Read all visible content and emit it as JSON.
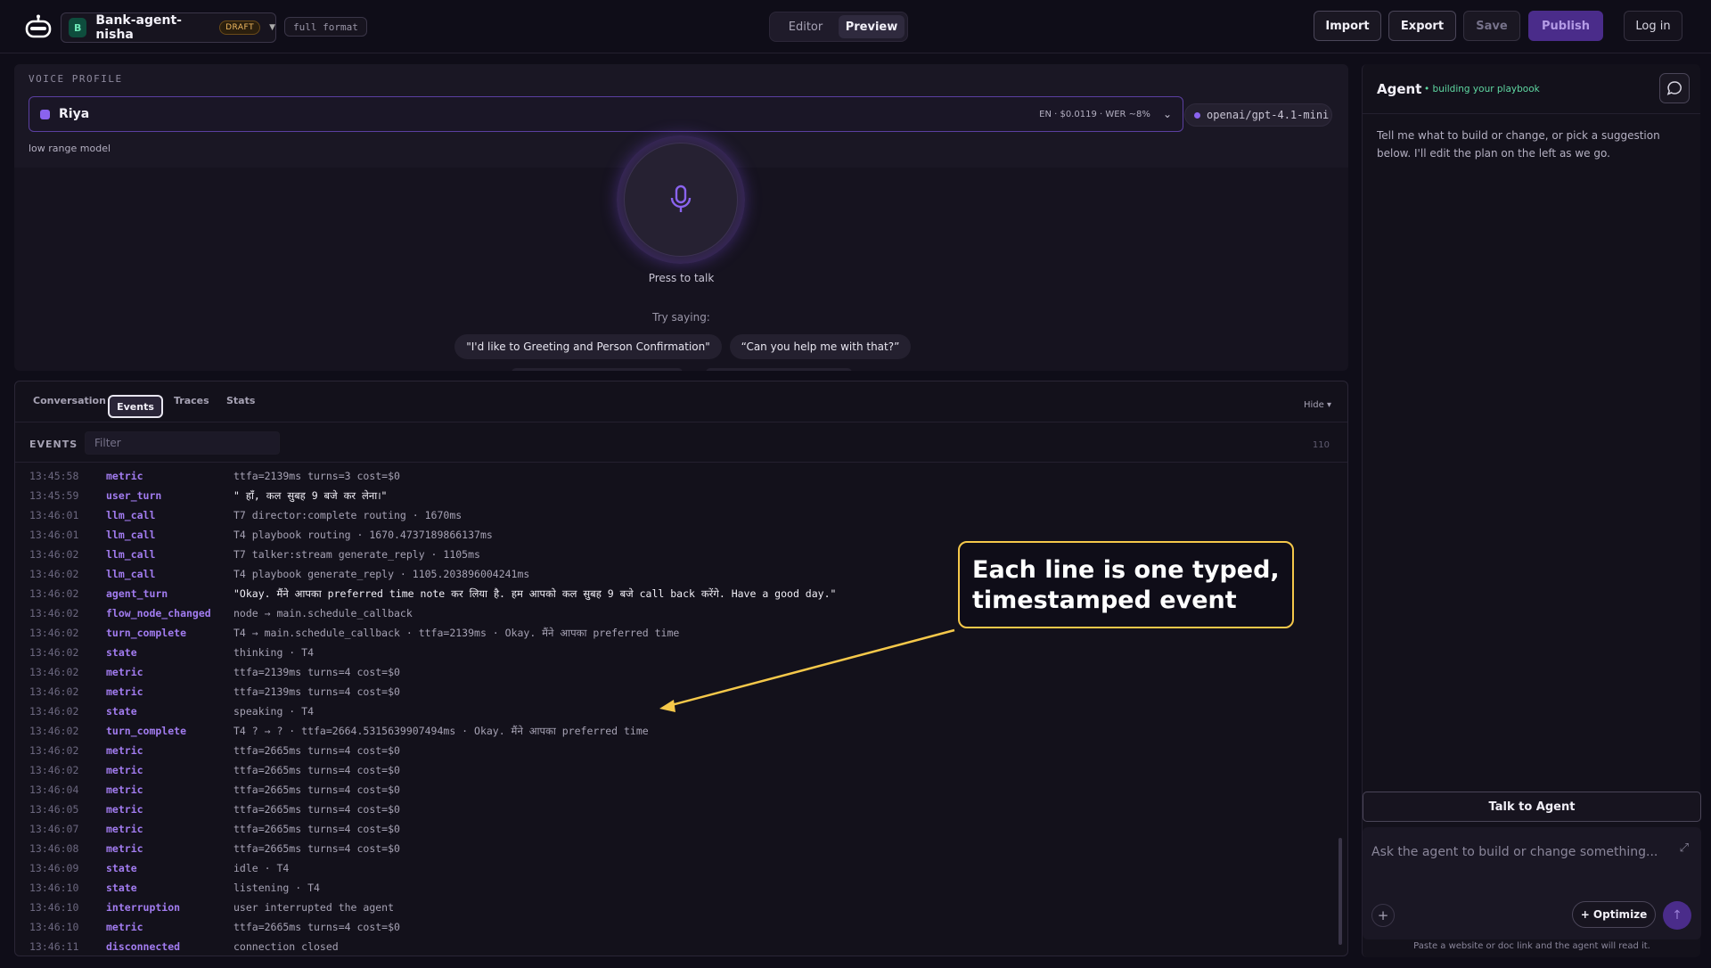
{
  "header": {
    "agent_initial": "B",
    "agent_name": "Bank-agent-nisha",
    "draft_badge": "DRAFT",
    "format_badge": "full format",
    "mode_tabs": [
      "Editor",
      "Preview"
    ],
    "active_mode": "Preview",
    "buttons": {
      "import": "Import",
      "export": "Export",
      "save": "Save",
      "publish": "Publish",
      "login": "Log in"
    }
  },
  "voice": {
    "section_title": "VOICE PROFILE",
    "voice_name": "Riya",
    "voice_meta": "EN · $0.0119 · WER ~8%",
    "model": "openai/gpt-4.1-mini",
    "note": "low range model",
    "press_label": "Press to talk",
    "try_label": "Try saying:",
    "suggestions": [
      "\"I'd like to Greeting and Person Confirmation\"",
      "“Can you help me with that?”"
    ]
  },
  "events_panel": {
    "tabs": [
      "Conversation",
      "Events",
      "Traces",
      "Stats"
    ],
    "active_tab": "Events",
    "hide_label": "Hide ▾",
    "section_label": "EVENTS",
    "filter_placeholder": "Filter",
    "count": "110",
    "events": [
      {
        "time": "13:45:58",
        "kind": "metric",
        "detail": "ttfa=2139ms turns=3 cost=$0"
      },
      {
        "time": "13:45:59",
        "kind": "user_turn",
        "detail": "\" हाँ, कल सुबह 9 बजे कर लेना।\""
      },
      {
        "time": "13:46:01",
        "kind": "llm_call",
        "detail": "T7 director:complete routing · 1670ms"
      },
      {
        "time": "13:46:01",
        "kind": "llm_call",
        "detail": "T4 playbook routing · 1670.4737189866137ms"
      },
      {
        "time": "13:46:02",
        "kind": "llm_call",
        "detail": "T7 talker:stream generate_reply · 1105ms"
      },
      {
        "time": "13:46:02",
        "kind": "llm_call",
        "detail": "T4 playbook generate_reply · 1105.203896004241ms"
      },
      {
        "time": "13:46:02",
        "kind": "agent_turn",
        "detail": "\"Okay. मैंने आपका preferred time note कर लिया है. हम आपको कल सुबह 9 बजे call back करेंगे. Have a good day.\""
      },
      {
        "time": "13:46:02",
        "kind": "flow_node_changed",
        "detail": "node → main.schedule_callback"
      },
      {
        "time": "13:46:02",
        "kind": "turn_complete",
        "detail": "T4 → main.schedule_callback · ttfa=2139ms · Okay. मैंने आपका preferred time"
      },
      {
        "time": "13:46:02",
        "kind": "state",
        "detail": "thinking · T4"
      },
      {
        "time": "13:46:02",
        "kind": "metric",
        "detail": "ttfa=2139ms turns=4 cost=$0"
      },
      {
        "time": "13:46:02",
        "kind": "metric",
        "detail": "ttfa=2139ms turns=4 cost=$0"
      },
      {
        "time": "13:46:02",
        "kind": "state",
        "detail": "speaking · T4"
      },
      {
        "time": "13:46:02",
        "kind": "turn_complete",
        "detail": "T4 ? → ? · ttfa=2664.5315639907494ms · Okay. मैंने आपका preferred time"
      },
      {
        "time": "13:46:02",
        "kind": "metric",
        "detail": "ttfa=2665ms turns=4 cost=$0"
      },
      {
        "time": "13:46:02",
        "kind": "metric",
        "detail": "ttfa=2665ms turns=4 cost=$0"
      },
      {
        "time": "13:46:04",
        "kind": "metric",
        "detail": "ttfa=2665ms turns=4 cost=$0"
      },
      {
        "time": "13:46:05",
        "kind": "metric",
        "detail": "ttfa=2665ms turns=4 cost=$0"
      },
      {
        "time": "13:46:07",
        "kind": "metric",
        "detail": "ttfa=2665ms turns=4 cost=$0"
      },
      {
        "time": "13:46:08",
        "kind": "metric",
        "detail": "ttfa=2665ms turns=4 cost=$0"
      },
      {
        "time": "13:46:09",
        "kind": "state",
        "detail": "idle · T4"
      },
      {
        "time": "13:46:10",
        "kind": "state",
        "detail": "listening · T4"
      },
      {
        "time": "13:46:10",
        "kind": "interruption",
        "detail": "user interrupted the agent"
      },
      {
        "time": "13:46:10",
        "kind": "metric",
        "detail": "ttfa=2665ms turns=4 cost=$0"
      },
      {
        "time": "13:46:11",
        "kind": "disconnected",
        "detail": "connection closed"
      }
    ]
  },
  "annotation": {
    "line1": "Each line is one typed,",
    "line2": "timestamped event"
  },
  "agent_panel": {
    "title": "Agent",
    "status": "• building your playbook",
    "intro": "Tell me what to build or change, or pick a suggestion below. I'll edit the plan on the left as we go.",
    "talk_button": "Talk to Agent",
    "composer_placeholder": "Ask the agent to build or change something...",
    "optimize_label": "+ Optimize",
    "hint": "Paste a website or doc link and the agent will read it."
  },
  "colors": {
    "accent": "#8a63ee",
    "event_kind": "#a27cf0",
    "annotation_border": "#f5c84a",
    "status_green": "#5fd8a2"
  },
  "icons": [
    "robot-logo-icon",
    "chevron-down-icon",
    "microphone-icon",
    "chat-bubble-icon",
    "expand-icon",
    "plus-icon",
    "arrow-up-icon"
  ]
}
